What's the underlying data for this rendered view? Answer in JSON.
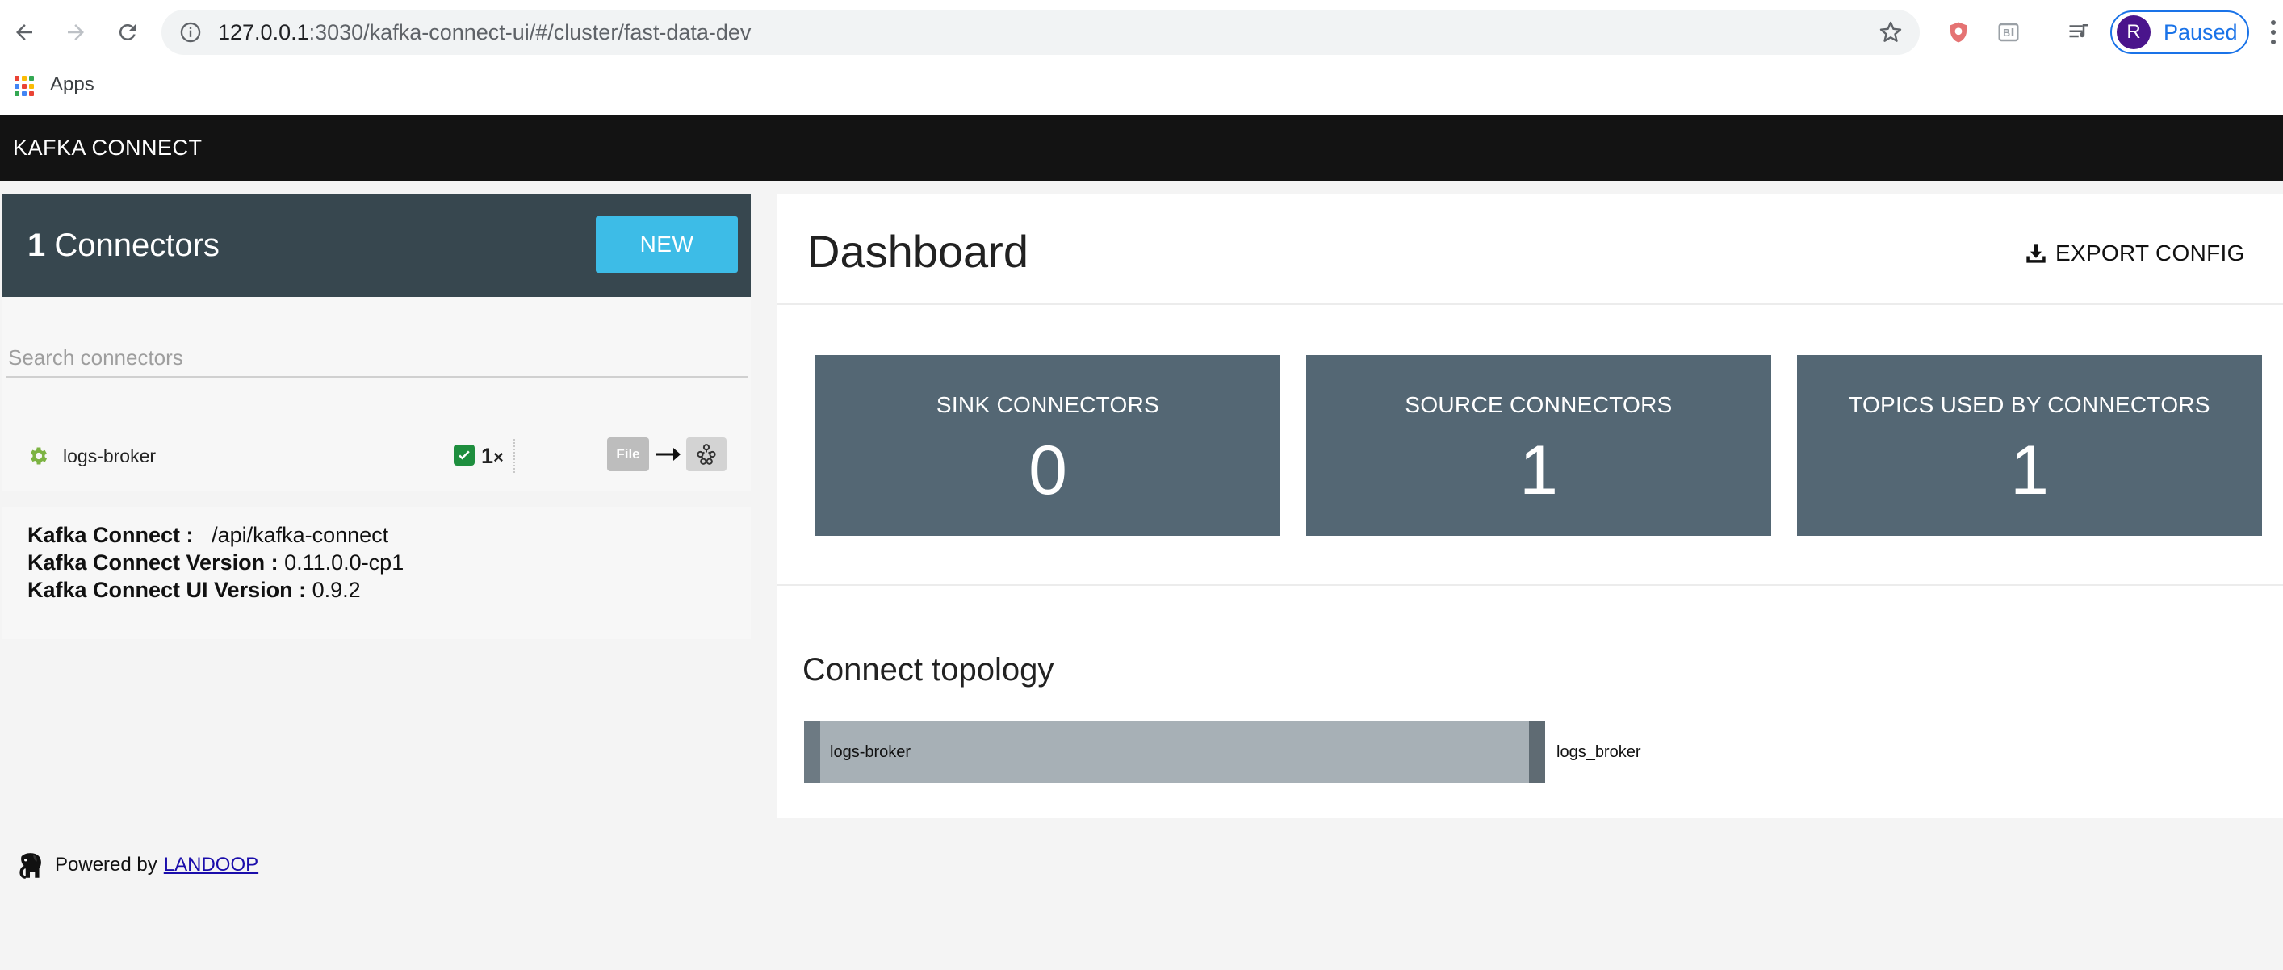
{
  "browser": {
    "url_host": "127.0.0.1",
    "url_path": ":3030/kafka-connect-ui/#/cluster/fast-data-dev",
    "profile_initial": "R",
    "profile_status": "Paused",
    "bookmarks": {
      "apps_label": "Apps"
    }
  },
  "app": {
    "brand": "KAFKA CONNECT"
  },
  "connectors": {
    "count": "1",
    "title": "Connectors",
    "new_label": "NEW",
    "search_placeholder": "Search connectors",
    "items": [
      {
        "name": "logs-broker",
        "tasks": "1",
        "tasks_suffix": "×",
        "source_badge": "File",
        "status": "running"
      }
    ]
  },
  "info": {
    "connect_label": "Kafka Connect :",
    "connect_value": "/api/kafka-connect",
    "version_label": "Kafka Connect Version :",
    "version_value": "0.11.0.0-cp1",
    "ui_version_label": "Kafka Connect UI Version :",
    "ui_version_value": "0.9.2"
  },
  "footer": {
    "powered_by": "Powered by",
    "link_text": "LANDOOP"
  },
  "dashboard": {
    "title": "Dashboard",
    "export_label": "EXPORT CONFIG",
    "stats": [
      {
        "label": "SINK CONNECTORS",
        "value": "0"
      },
      {
        "label": "SOURCE CONNECTORS",
        "value": "1"
      },
      {
        "label": "TOPICS USED BY CONNECTORS",
        "value": "1"
      }
    ],
    "topology": {
      "title": "Connect topology",
      "connector": "logs-broker",
      "topic": "logs_broker"
    }
  },
  "colors": {
    "nav_bg": "#131313",
    "header_bg": "#37474f",
    "accent": "#3dbce7",
    "card_bg": "#546774",
    "running_green": "#1e8e3e"
  }
}
